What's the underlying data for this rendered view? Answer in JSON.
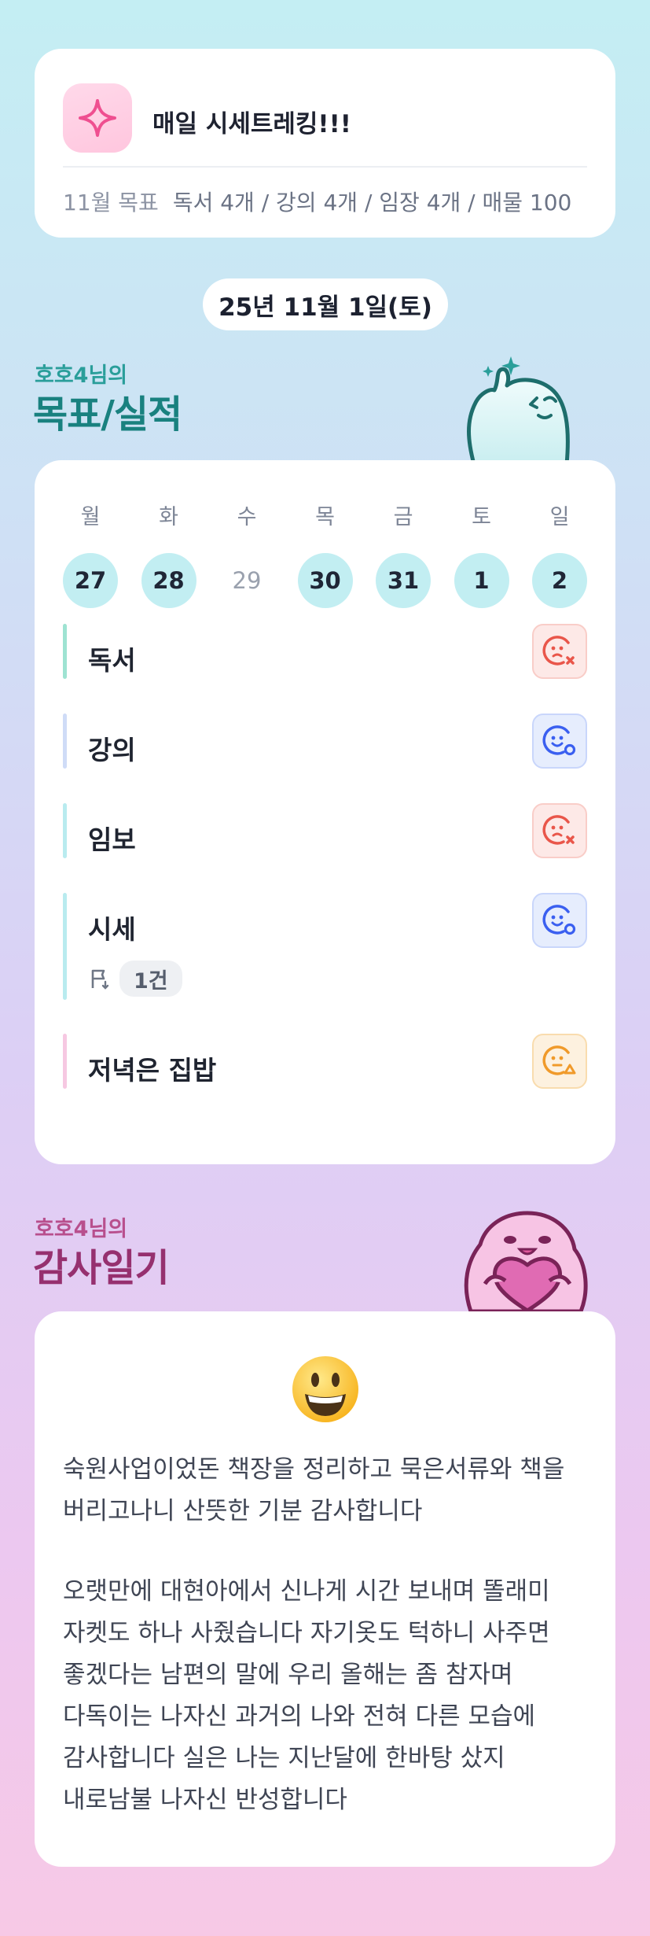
{
  "app": {
    "title": "매일 시세트레킹!!!",
    "goal_label": "11월 목표",
    "goal_text": "독서 4개 / 강의 4개 / 임장 4개 / 매물 100"
  },
  "date": "25년 11월 1일(토)",
  "section_goals": {
    "subtitle": "호호4님의",
    "title": "목표/실적"
  },
  "week": [
    {
      "name": "월",
      "num": "27",
      "filled": true
    },
    {
      "name": "화",
      "num": "28",
      "filled": true
    },
    {
      "name": "수",
      "num": "29",
      "filled": false
    },
    {
      "name": "목",
      "num": "30",
      "filled": true
    },
    {
      "name": "금",
      "num": "31",
      "filled": true
    },
    {
      "name": "토",
      "num": "1",
      "filled": true
    },
    {
      "name": "일",
      "num": "2",
      "filled": true
    }
  ],
  "goals": [
    {
      "name": "독서",
      "status": "fail",
      "bar_color": "#9ee3d2"
    },
    {
      "name": "강의",
      "status": "done",
      "bar_color": "#cfdcf7"
    },
    {
      "name": "임보",
      "status": "fail",
      "bar_color": "#b9ebef"
    },
    {
      "name": "시세",
      "status": "done",
      "bar_color": "#b9ebef",
      "count": "1건"
    },
    {
      "name": "저녁은 집밥",
      "status": "warn",
      "bar_color": "#f6c8e2"
    }
  ],
  "section_diary": {
    "subtitle": "호호4님의",
    "title": "감사일기"
  },
  "diary": {
    "p1": "숙원사업이었돈 책장을 정리하고 묵은서류와 책을 버리고나니 산뜻한 기분 감사합니다",
    "p2": "오랫만에 대현아에서 신나게 시간 보내며 똘래미 자켓도 하나 사줬습니다 자기옷도 턱하니 사주면 좋겠다는 남편의 말에 우리 올해는 좀 참자며 다독이는 나자신 과거의 나와 전혀 다른 모습에 감사합니다 실은 나는 지난달에 한바탕 샀지 내로남불 나자신 반성합니다"
  },
  "colors": {
    "day_fill": "#c2eef2",
    "teal_title": "#19817f",
    "plum_title": "#96306f"
  }
}
